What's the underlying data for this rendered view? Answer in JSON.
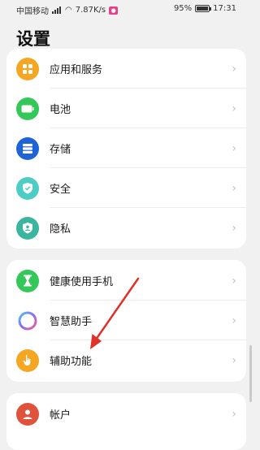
{
  "status_bar": {
    "carrier": "中国移动",
    "network_speed": "7.87K/s",
    "battery_percent": "95%",
    "time": "17:31"
  },
  "page": {
    "title": "设置"
  },
  "groups": [
    {
      "items": [
        {
          "label": "应用和服务",
          "icon": "apps-icon",
          "color": "#f5a623"
        },
        {
          "label": "电池",
          "icon": "battery-icon",
          "color": "#34c759"
        },
        {
          "label": "存储",
          "icon": "storage-icon",
          "color": "#1f64d6"
        },
        {
          "label": "安全",
          "icon": "security-shield-icon",
          "color": "#4ecdc4"
        },
        {
          "label": "隐私",
          "icon": "privacy-shield-icon",
          "color": "#3ab59e"
        }
      ]
    },
    {
      "items": [
        {
          "label": "健康使用手机",
          "icon": "hourglass-icon",
          "color": "#34c759"
        },
        {
          "label": "智慧助手",
          "icon": "assistant-ring-icon",
          "color": "#8a6cf0"
        },
        {
          "label": "辅助功能",
          "icon": "hand-icon",
          "color": "#f5a623"
        }
      ]
    },
    {
      "items": [
        {
          "label": "帐户",
          "icon": "user-icon",
          "color": "#e0523c"
        }
      ]
    }
  ],
  "annotation": {
    "color": "#e0302a"
  }
}
